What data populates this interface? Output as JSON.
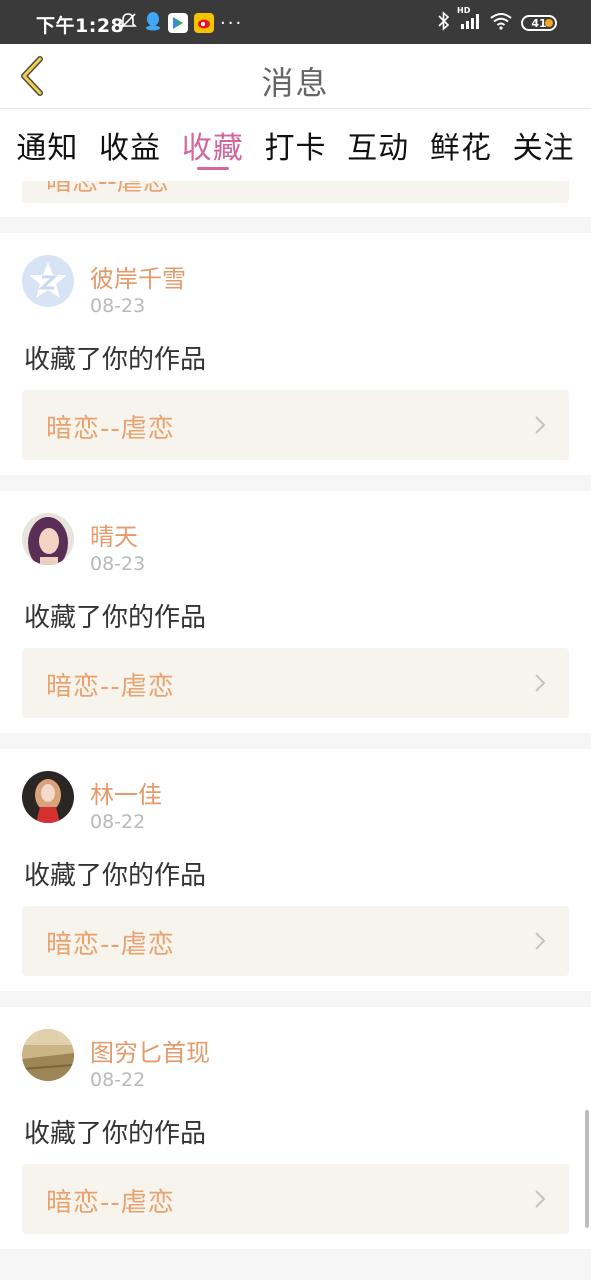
{
  "status_bar": {
    "time": "下午1:28",
    "battery": "41",
    "network": "HD"
  },
  "header": {
    "title": "消息"
  },
  "tabs": [
    {
      "label": "通知",
      "active": false
    },
    {
      "label": "收益",
      "active": false
    },
    {
      "label": "收藏",
      "active": true
    },
    {
      "label": "打卡",
      "active": false
    },
    {
      "label": "互动",
      "active": false
    },
    {
      "label": "鲜花",
      "active": false
    },
    {
      "label": "关注",
      "active": false
    }
  ],
  "partial_item": {
    "work_title": "暗恋--虐恋"
  },
  "items": [
    {
      "name": "彼岸千雪",
      "date": "08-23",
      "action": "收藏了你的作品",
      "work_title": "暗恋--虐恋",
      "avatar": "default-avatar-icon"
    },
    {
      "name": "晴天",
      "date": "08-23",
      "action": "收藏了你的作品",
      "work_title": "暗恋--虐恋",
      "avatar": "user-photo"
    },
    {
      "name": "林一佳",
      "date": "08-22",
      "action": "收藏了你的作品",
      "work_title": "暗恋--虐恋",
      "avatar": "user-photo"
    },
    {
      "name": "图穷匕首现",
      "date": "08-22",
      "action": "收藏了你的作品",
      "work_title": "暗恋--虐恋",
      "avatar": "user-photo"
    }
  ],
  "colors": {
    "accent": "#d4669e",
    "name": "#e59a6b",
    "work_title": "#e8a270",
    "work_bg": "#f6f4ec"
  }
}
